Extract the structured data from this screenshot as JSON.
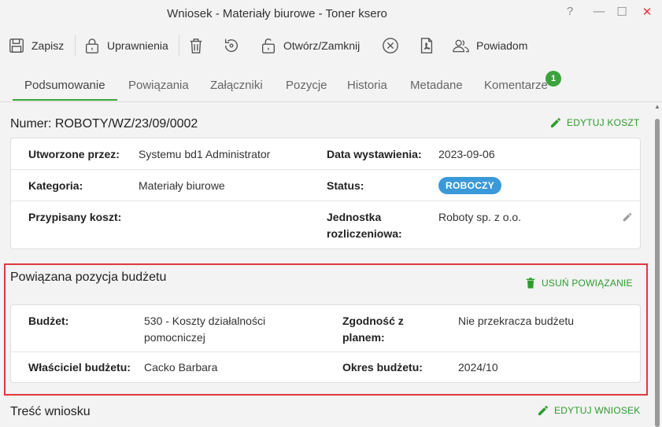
{
  "window": {
    "title": "Wniosek - Materiały biurowe - Toner ksero",
    "help": "?",
    "minimize": "—",
    "maximize": "☐",
    "close": "✕"
  },
  "toolbar": {
    "save": "Zapisz",
    "permissions": "Uprawnienia",
    "open_close": "Otwórz/Zamknij",
    "notify": "Powiadom"
  },
  "tabs": [
    {
      "label": "Podsumowanie"
    },
    {
      "label": "Powiązania"
    },
    {
      "label": "Załączniki"
    },
    {
      "label": "Pozycje"
    },
    {
      "label": "Historia"
    },
    {
      "label": "Metadane"
    },
    {
      "label": "Komentarze",
      "badge": "1"
    }
  ],
  "summary": {
    "number_label": "Numer: ROBOTY/WZ/23/09/0002",
    "edit_cost": "EDYTUJ KOSZT",
    "created_by_label": "Utworzone przez:",
    "created_by": "Systemu bd1 Administrator",
    "issue_date_label": "Data wystawienia:",
    "issue_date": "2023-09-06",
    "category_label": "Kategoria:",
    "category": "Materiały biurowe",
    "status_label": "Status:",
    "status": "ROBOCZY",
    "assigned_cost_label": "Przypisany koszt:",
    "unit_label_1": "Jednostka",
    "unit_label_2": "rozliczeniowa:",
    "unit": "Roboty sp. z o.o."
  },
  "budget": {
    "title": "Powiązana pozycja budżetu",
    "remove": "USUŃ POWIĄZANIE",
    "budget_label": "Budżet:",
    "budget_1": "530 - Koszty działalności",
    "budget_2": "pomocniczej",
    "plan_label_1": "Zgodność z",
    "plan_label_2": "planem:",
    "plan": "Nie przekracza budżetu",
    "owner_label": "Właściciel budżetu:",
    "owner": "Cacko Barbara",
    "period_label": "Okres budżetu:",
    "period": "2024/10"
  },
  "request": {
    "title": "Treść wniosku",
    "edit": "EDYTUJ WNIOSEK"
  },
  "colors": {
    "accent": "#3aa43a",
    "status": "#3a9ad9",
    "highlight": "#e0383e"
  }
}
